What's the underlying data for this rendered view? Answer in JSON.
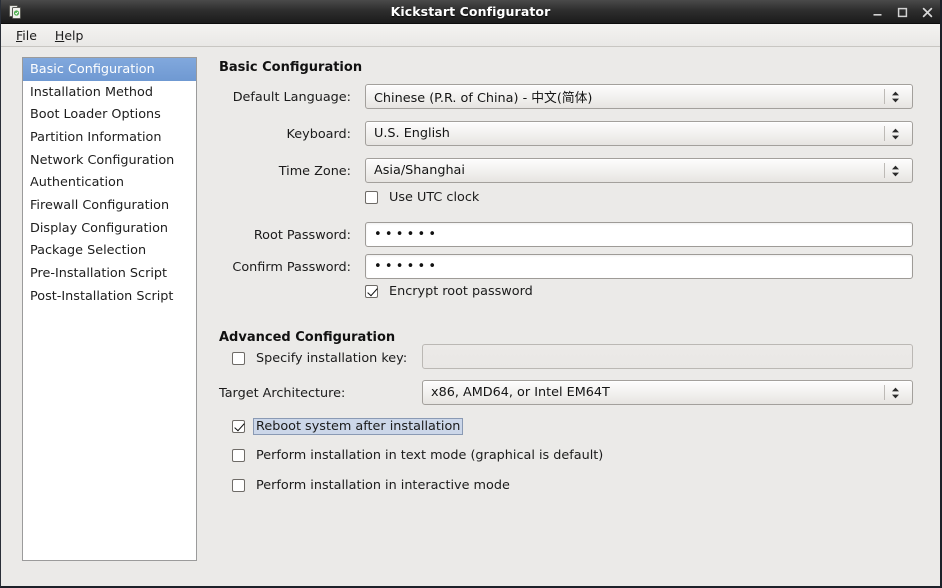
{
  "window": {
    "title": "Kickstart Configurator",
    "icon": "kickstart-app-icon",
    "controls": {
      "minimize": "minimize-icon",
      "maximize": "maximize-icon",
      "close": "close-icon"
    }
  },
  "menubar": {
    "items": [
      {
        "label": "File",
        "accel": "F"
      },
      {
        "label": "Help",
        "accel": "H"
      }
    ]
  },
  "sidebar": {
    "items": [
      {
        "label": "Basic Configuration",
        "selected": true
      },
      {
        "label": "Installation Method",
        "selected": false
      },
      {
        "label": "Boot Loader Options",
        "selected": false
      },
      {
        "label": "Partition Information",
        "selected": false
      },
      {
        "label": "Network Configuration",
        "selected": false
      },
      {
        "label": "Authentication",
        "selected": false
      },
      {
        "label": "Firewall Configuration",
        "selected": false
      },
      {
        "label": "Display Configuration",
        "selected": false
      },
      {
        "label": "Package Selection",
        "selected": false
      },
      {
        "label": "Pre-Installation Script",
        "selected": false
      },
      {
        "label": "Post-Installation Script",
        "selected": false
      }
    ]
  },
  "basic": {
    "heading": "Basic Configuration",
    "language_label": "Default Language:",
    "language_value": "Chinese (P.R. of China) - 中文(简体)",
    "keyboard_label": "Keyboard:",
    "keyboard_value": "U.S. English",
    "timezone_label": "Time Zone:",
    "timezone_value": "Asia/Shanghai",
    "utc_label": "Use UTC clock",
    "utc_checked": false,
    "root_password_label": "Root Password:",
    "root_password_value": "••••••",
    "confirm_password_label": "Confirm Password:",
    "confirm_password_value": "••••••",
    "encrypt_label": "Encrypt root password",
    "encrypt_checked": true
  },
  "advanced": {
    "heading": "Advanced Configuration",
    "install_key_label": "Specify installation key:",
    "install_key_checked": false,
    "install_key_value": "",
    "arch_label": "Target Architecture:",
    "arch_value": "x86, AMD64, or Intel EM64T",
    "reboot_label": "Reboot system after installation",
    "reboot_checked": true,
    "textmode_label": "Perform installation in text mode (graphical is default)",
    "textmode_checked": false,
    "interactive_label": "Perform installation in interactive mode",
    "interactive_checked": false
  },
  "colors": {
    "selection": "#7099d4",
    "window_bg": "#ebeae8",
    "titlebar": "#2e2e2e",
    "focus_highlight": "#ccd7e9"
  }
}
